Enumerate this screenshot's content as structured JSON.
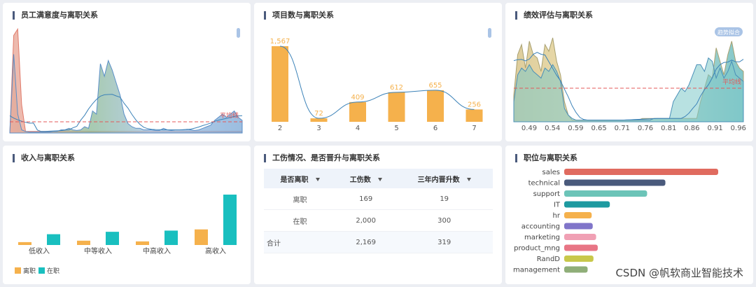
{
  "panels": {
    "satisfaction": {
      "title": "员工满意度与离职关系",
      "avg_label": "平均线"
    },
    "projects": {
      "title": "项目数与离职关系"
    },
    "evaluation": {
      "title": "绩效评估与离职关系",
      "avg_label": "平均线",
      "fit_label": "趋势拟合"
    },
    "salary": {
      "title": "收入与离职关系"
    },
    "accident": {
      "title": "工伤情况、是否晋升与离职关系"
    },
    "position": {
      "title": "职位与离职关系"
    }
  },
  "colors": {
    "orange": "#f5b14c",
    "teal": "#19bfbf",
    "line": "#3b82b8",
    "avg": "#e35a5a"
  },
  "watermark": "CSDN @帆软商业智能技术",
  "chart_data": [
    {
      "type": "area",
      "id": "satisfaction",
      "title": "员工满意度与离职关系",
      "series": [
        {
          "values": [
            0,
            310,
            330,
            90,
            5,
            5,
            5,
            5,
            5,
            5,
            5,
            5,
            5,
            5,
            5,
            5,
            5,
            5,
            5,
            5,
            5,
            5,
            5,
            5,
            5,
            5,
            5,
            5,
            5,
            5,
            5,
            5,
            5,
            5,
            5,
            5,
            5,
            5,
            5,
            5,
            5,
            5,
            5,
            5,
            5,
            5,
            5,
            5,
            5,
            5,
            5,
            5,
            5,
            5,
            5,
            5,
            5,
            5,
            5,
            5
          ]
        },
        {
          "values": [
            0,
            250,
            60,
            10,
            5,
            3,
            3,
            3,
            3,
            3,
            3,
            5,
            5,
            10,
            10,
            15,
            10,
            8,
            10,
            20,
            15,
            70,
            60,
            220,
            180,
            230,
            200,
            160,
            120,
            60,
            30,
            20,
            15,
            15,
            10,
            10,
            10,
            8,
            8,
            15,
            10,
            8,
            10,
            10,
            10,
            12,
            10,
            8,
            10,
            15,
            20,
            25,
            40,
            50,
            60,
            50,
            60,
            70,
            50,
            40
          ]
        }
      ]
    },
    {
      "type": "bar",
      "id": "projects",
      "title": "项目数与离职关系",
      "categories": [
        "2",
        "3",
        "4",
        "5",
        "6",
        "7"
      ],
      "values": [
        1567,
        72,
        409,
        612,
        655,
        256
      ],
      "value_labels": [
        "1,567",
        "72",
        "409",
        "612",
        "655",
        "256"
      ]
    },
    {
      "type": "area",
      "id": "evaluation",
      "title": "绩效评估与离职关系",
      "x_ticks": [
        "0.49",
        "0.54",
        "0.59",
        "0.65",
        "0.71",
        "0.76",
        "0.81",
        "0.86",
        "0.91",
        "0.96"
      ],
      "series": [
        {
          "values": [
            80,
            200,
            230,
            160,
            240,
            200,
            190,
            150,
            230,
            210,
            250,
            180,
            140,
            60,
            20,
            5,
            5,
            5,
            5,
            5,
            5,
            5,
            5,
            5,
            5,
            5,
            5,
            5,
            5,
            5,
            5,
            5,
            5,
            10,
            10,
            10,
            10,
            10,
            10,
            10,
            10,
            10,
            10,
            10,
            10,
            10,
            10,
            10,
            60,
            100,
            140,
            130,
            220,
            180,
            140,
            200,
            240,
            180,
            160,
            150
          ]
        },
        {
          "values": [
            60,
            140,
            160,
            150,
            170,
            150,
            140,
            130,
            160,
            150,
            170,
            150,
            120,
            40,
            20,
            10,
            5,
            5,
            5,
            5,
            5,
            5,
            5,
            5,
            5,
            5,
            5,
            5,
            5,
            5,
            5,
            5,
            5,
            5,
            5,
            5,
            10,
            10,
            10,
            10,
            10,
            60,
            80,
            100,
            90,
            110,
            140,
            170,
            170,
            150,
            190,
            180,
            130,
            160,
            130,
            150,
            180,
            140,
            130,
            120
          ]
        }
      ]
    },
    {
      "type": "bar",
      "id": "salary",
      "title": "收入与离职关系",
      "categories": [
        "低收入",
        "中等收入",
        "中高收入",
        "高收入"
      ],
      "series": [
        {
          "name": "离职",
          "values": [
            1.2,
            1.8,
            1.5,
            6.5
          ]
        },
        {
          "name": "在职",
          "values": [
            4.5,
            5.5,
            6.0,
            21.0
          ]
        }
      ]
    },
    {
      "type": "table",
      "id": "accident",
      "title": "工伤情况、是否晋升与离职关系",
      "columns": [
        "是否离职",
        "工伤数",
        "三年内晋升数"
      ],
      "rows": [
        [
          "离职",
          "169",
          "19"
        ],
        [
          "在职",
          "2,000",
          "300"
        ]
      ],
      "total": [
        "合计",
        "2,169",
        "319"
      ]
    },
    {
      "type": "bar",
      "id": "position",
      "title": "职位与离职关系",
      "categories": [
        "sales",
        "technical",
        "support",
        "IT",
        "hr",
        "accounting",
        "marketing",
        "product_mng",
        "RandD",
        "management"
      ],
      "values": [
        4140,
        2720,
        2229,
        1227,
        739,
        767,
        858,
        902,
        787,
        630
      ],
      "colors": [
        "#e06b5f",
        "#4a5a7c",
        "#6cc4b8",
        "#1e9aa0",
        "#f5b14c",
        "#8075c9",
        "#f0a0b4",
        "#e87585",
        "#c8c84a",
        "#8fae78"
      ]
    }
  ]
}
